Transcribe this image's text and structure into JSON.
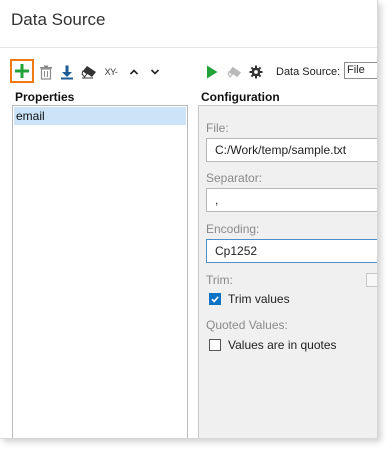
{
  "window": {
    "title": "Data Source"
  },
  "toolbar": {
    "add": "add-icon",
    "delete": "trash-icon",
    "import": "download-icon",
    "clear": "eraser-icon",
    "xy_label": "XY-",
    "move_up": "chevron-up-icon",
    "move_down": "chevron-down-icon",
    "run": "play-icon",
    "clear_source": "eraser-icon",
    "settings": "gear-icon",
    "data_source_label": "Data Source:",
    "data_source_value": "File",
    "highlight_color": "#ee7a16",
    "add_color": "#21a33a"
  },
  "properties": {
    "heading": "Properties",
    "items": [
      {
        "label": "email",
        "selected": true
      }
    ]
  },
  "configuration": {
    "heading": "Configuration",
    "file_label": "File:",
    "file_value": "C:/Work/temp/sample.txt",
    "separator_label": "Separator:",
    "separator_value": ",",
    "encoding_label": "Encoding:",
    "encoding_value": "Cp1252",
    "trim_label": "Trim:",
    "trim_values_label": "Trim values",
    "trim_values_checked": true,
    "quoted_label": "Quoted Values:",
    "quoted_values_label": "Values are in quotes",
    "quoted_values_checked": false
  }
}
